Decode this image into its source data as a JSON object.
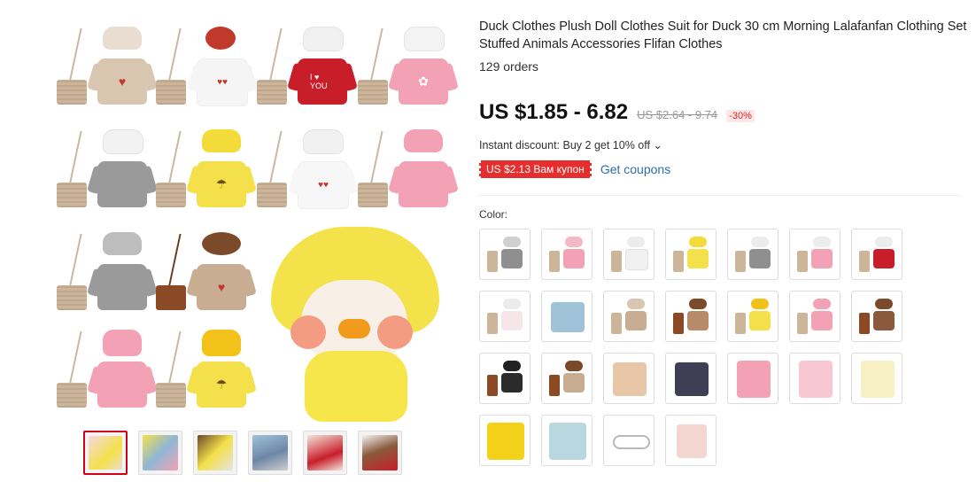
{
  "product": {
    "title": "Duck Clothes Plush Doll Clothes Suit for Duck 30 cm Morning Lalafanfan Clothing Set Stuffed Animals Accessories Flifan Clothes",
    "orders": "129 orders",
    "price": "US $1.85 - 6.82",
    "old_price": "US $2.64 - 9.74",
    "discount": "-30%",
    "instant_discount": "Instant discount: Buy 2 get 10% off ⌄",
    "coupon": "US $2.13 Вам купон",
    "get_coupons": "Get coupons",
    "color_label": "Color:"
  },
  "colors": {
    "coupon_red": "#e62e2e",
    "link_blue": "#2f6ea7",
    "active_thumb_border": "#d0021b"
  },
  "gallery": {
    "active_index": 0,
    "thumbnails": [
      "collage",
      "outfits",
      "outfits-2",
      "duck-overalls",
      "girl-red",
      "bear-red"
    ]
  },
  "swatch_rows": 4
}
